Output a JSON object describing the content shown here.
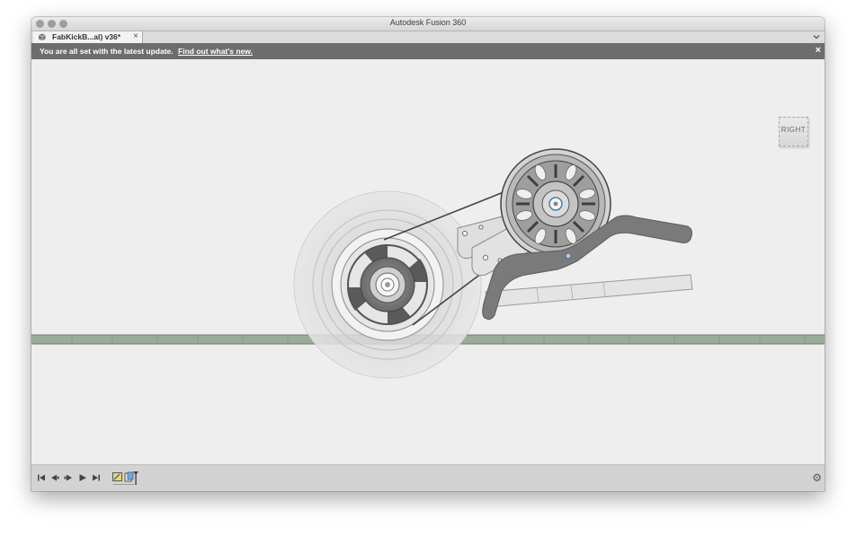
{
  "window": {
    "title": "Autodesk Fusion 360",
    "traffic_lights": [
      "close",
      "minimize",
      "zoom"
    ]
  },
  "tab": {
    "label": "FabKickB...al) v36*",
    "close_glyph": "×",
    "icon": "document-box-icon"
  },
  "banner": {
    "message": "You are all set with the latest update.",
    "link": "Find out what's new.",
    "close_glyph": "×"
  },
  "viewcube": {
    "label": "RIGHT"
  },
  "timeline": {
    "controls": [
      "go-to-start-icon",
      "step-back-icon",
      "step-forward-icon",
      "play-icon",
      "go-to-end-icon"
    ],
    "features": [
      "sketch-feature-icon",
      "component-feature-icon",
      "timeline-marker-icon"
    ]
  },
  "settings": {
    "icon": "gear-icon",
    "glyph": "⚙"
  },
  "colors": {
    "canvas": "#eeeeee",
    "banner": "#6d6d6d",
    "ground_strip": "#9bab9a",
    "bracket": "#7a7a7a"
  }
}
